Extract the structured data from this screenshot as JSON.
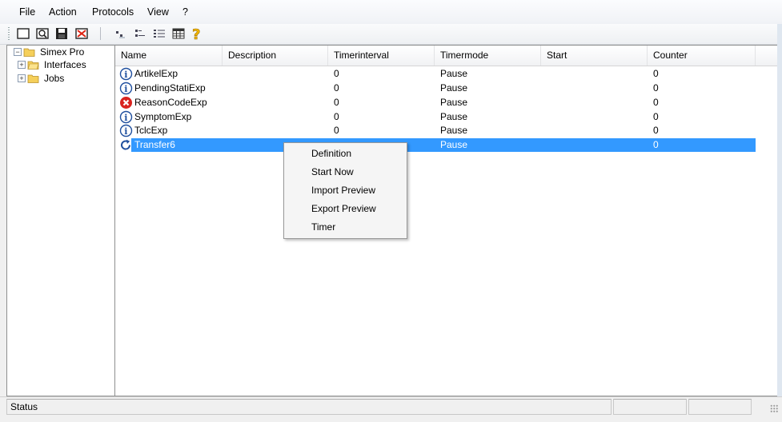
{
  "menu": [
    "File",
    "Action",
    "Protocols",
    "View",
    "?"
  ],
  "toolbar_icons": [
    "new-icon",
    "find-icon",
    "save-icon",
    "delete-icon",
    "small-icons-icon",
    "list-icon",
    "details-icon",
    "table-icon",
    "help-icon"
  ],
  "tree": [
    {
      "label": "Simex Pro",
      "expander": "−"
    },
    {
      "label": "Interfaces",
      "expander": "+"
    },
    {
      "label": "Jobs",
      "expander": "+"
    }
  ],
  "columns": [
    "Name",
    "Description",
    "Timerinterval",
    "Timermode",
    "Start",
    "Counter"
  ],
  "rows": [
    {
      "status_icon": "info-icon",
      "name": "ArtikelExp",
      "description": "",
      "interval": "0",
      "mode": "Pause",
      "start": "",
      "counter": "0"
    },
    {
      "status_icon": "info-icon",
      "name": "PendingStatiExp",
      "description": "",
      "interval": "0",
      "mode": "Pause",
      "start": "",
      "counter": "0"
    },
    {
      "status_icon": "error-icon",
      "name": "ReasonCodeExp",
      "description": "",
      "interval": "0",
      "mode": "Pause",
      "start": "",
      "counter": "0"
    },
    {
      "status_icon": "info-icon",
      "name": "SymptomExp",
      "description": "",
      "interval": "0",
      "mode": "Pause",
      "start": "",
      "counter": "0"
    },
    {
      "status_icon": "info-icon",
      "name": "TclcExp",
      "description": "",
      "interval": "0",
      "mode": "Pause",
      "start": "",
      "counter": "0"
    },
    {
      "status_icon": "refresh-icon",
      "name": "Transfer6",
      "description": "",
      "interval": "",
      "mode": "Pause",
      "start": "",
      "counter": "0",
      "selected": true
    }
  ],
  "context_menu": [
    "Definition",
    "Start Now",
    "Import Preview",
    "Export Preview",
    "Timer"
  ],
  "status": {
    "text": "Status"
  },
  "colors": {
    "selection": "#3399ff",
    "error": "#d9231f",
    "info": "#1f4f9e",
    "folder": "#f5cf5a",
    "help": "#f2b705"
  }
}
